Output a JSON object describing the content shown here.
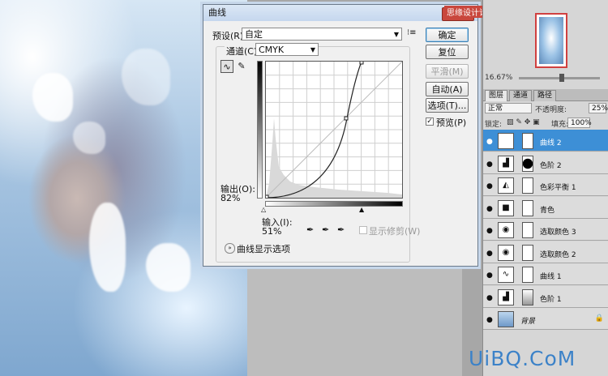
{
  "dialog": {
    "title": "曲线",
    "preset_label": "预设(R):",
    "preset_value": "自定",
    "channel_label": "通道(C):",
    "channel_value": "CMYK",
    "output_label": "输出(O):",
    "output_value": "82%",
    "input_label": "输入(I):",
    "input_value": "51%",
    "show_clipping_label": "显示修剪(W)",
    "curve_display_options": "曲线显示选项",
    "buttons": {
      "ok": "确定",
      "reset": "复位",
      "smooth": "平滑(M)",
      "auto": "自动(A)",
      "options": "选项(T)...",
      "preview": "预览(P)"
    }
  },
  "top_banner": "思缘设计论坛 www.missyuan.com",
  "navigator": {
    "zoom": "16.67%"
  },
  "layers_panel": {
    "tabs": [
      "图层",
      "通道",
      "路径"
    ],
    "blend_mode": "正常",
    "opacity_label": "不透明度:",
    "opacity_value": "25%",
    "lock_label": "锁定:",
    "fill_label": "填充:",
    "fill_value": "100%",
    "layers": [
      {
        "name": "曲线 2",
        "icon": "curves-icon",
        "selected": true
      },
      {
        "name": "色阶 2",
        "icon": "levels-icon",
        "selected": false
      },
      {
        "name": "色彩平衡 1",
        "icon": "color-balance-icon",
        "selected": false
      },
      {
        "name": "青色",
        "icon": "solid-fill-icon",
        "selected": false
      },
      {
        "name": "选取颜色 3",
        "icon": "selective-color-icon",
        "selected": false
      },
      {
        "name": "选取颜色 2",
        "icon": "selective-color-icon",
        "selected": false
      },
      {
        "name": "曲线 1",
        "icon": "curves-icon",
        "selected": false
      },
      {
        "name": "色阶 1",
        "icon": "levels-icon",
        "selected": false
      },
      {
        "name": "背景",
        "icon": "image-icon",
        "selected": false
      }
    ]
  },
  "watermark": "UiBQ.CoM"
}
